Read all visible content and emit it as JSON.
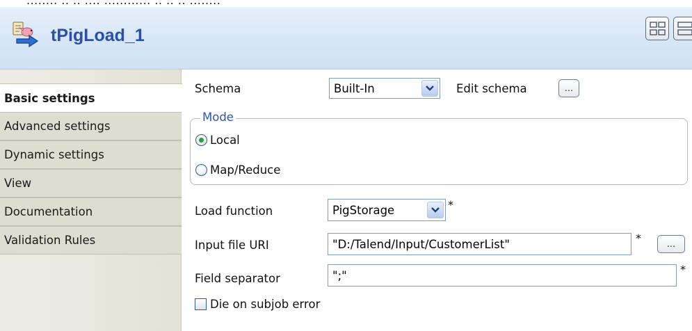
{
  "component": {
    "title": "tPigLoad_1",
    "icon": "pig-load-component-icon"
  },
  "header": {
    "view_buttons": [
      "compact-view-icon",
      "table-view-icon"
    ]
  },
  "tabs": [
    {
      "label": "Basic settings",
      "active": true
    },
    {
      "label": "Advanced settings",
      "active": false
    },
    {
      "label": "Dynamic settings",
      "active": false
    },
    {
      "label": "View",
      "active": false
    },
    {
      "label": "Documentation",
      "active": false
    },
    {
      "label": "Validation Rules",
      "active": false
    }
  ],
  "form": {
    "schema": {
      "label": "Schema",
      "value": "Built-In",
      "edit_label": "Edit schema",
      "edit_button": "..."
    },
    "mode": {
      "legend": "Mode",
      "options": [
        {
          "label": "Local",
          "selected": true
        },
        {
          "label": "Map/Reduce",
          "selected": false
        }
      ]
    },
    "load_function": {
      "label": "Load function",
      "value": "PigStorage",
      "required_mark": "*"
    },
    "input_file_uri": {
      "label": "Input file URI",
      "value": "\"D:/Talend/Input/CustomerList\"",
      "required_mark": "*",
      "browse_button": "..."
    },
    "field_separator": {
      "label": "Field separator",
      "value": "\";\"",
      "required_mark": "*"
    },
    "die_on_error": {
      "label": "Die on subjob error",
      "checked": false
    }
  },
  "colors": {
    "title": "#2a4fa8",
    "legend": "#2b57b5",
    "radio_dot": "#2f9a3b",
    "header_bg": "#d8e7f7"
  }
}
